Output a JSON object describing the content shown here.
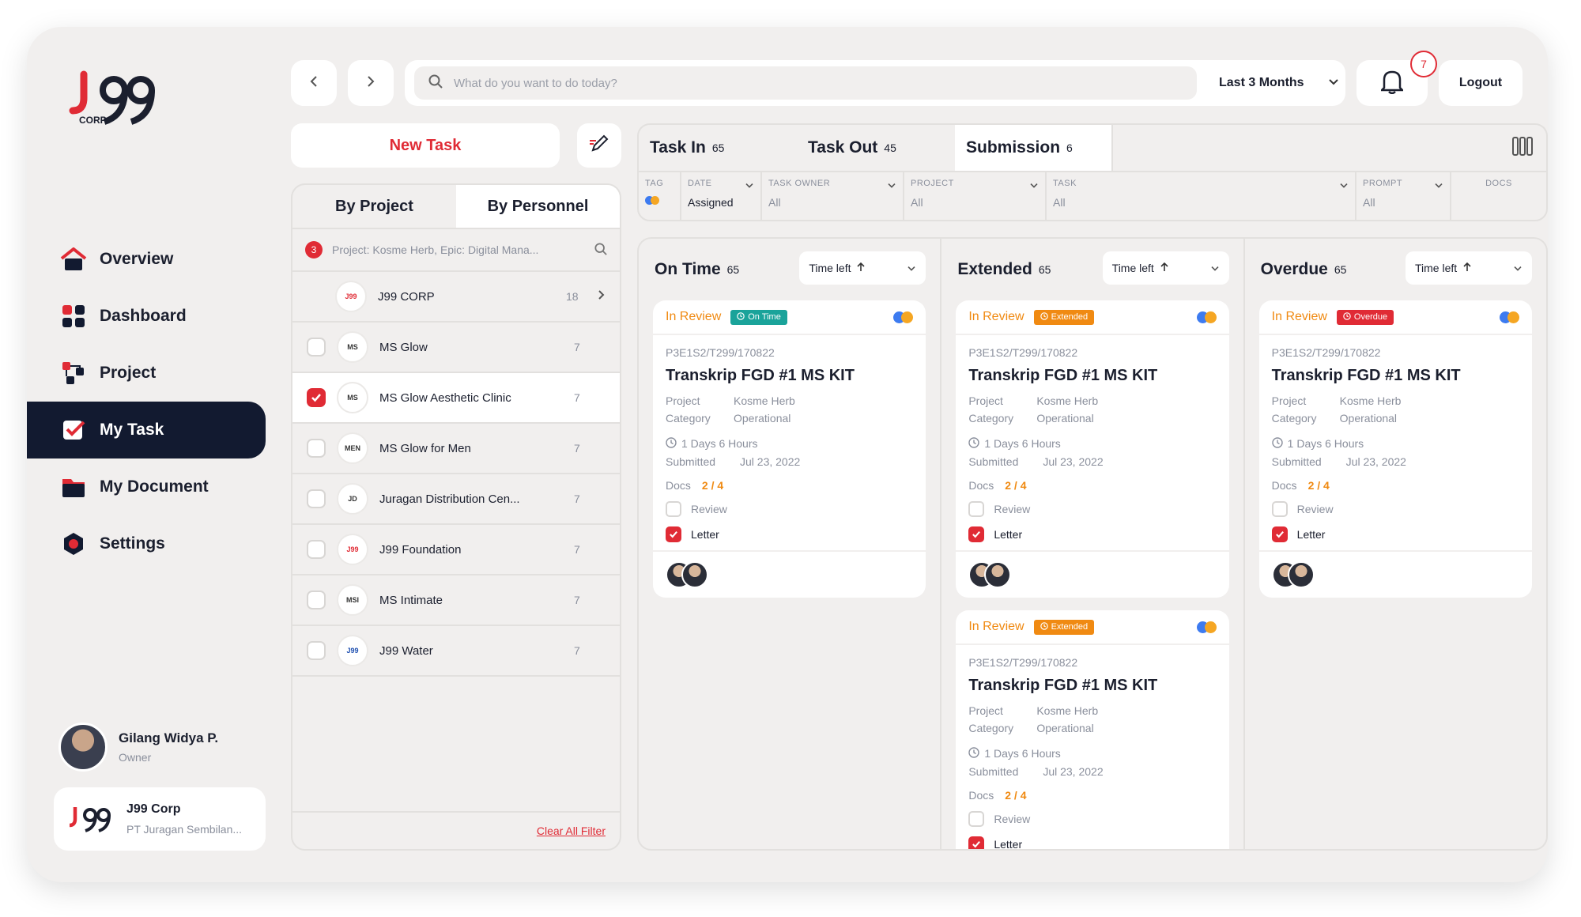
{
  "brand": {
    "logo_text": "J99",
    "logo_sub": "CORP."
  },
  "nav": [
    {
      "label": "Overview",
      "icon": "home-icon"
    },
    {
      "label": "Dashboard",
      "icon": "grid-icon"
    },
    {
      "label": "Project",
      "icon": "project-icon"
    },
    {
      "label": "My Task",
      "icon": "task-check-icon",
      "active": true
    },
    {
      "label": "My Document",
      "icon": "folder-icon"
    },
    {
      "label": "Settings",
      "icon": "gear-icon"
    }
  ],
  "user": {
    "name": "Gilang Widya P.",
    "role": "Owner"
  },
  "company": {
    "name": "J99 Corp",
    "subtitle": "PT Juragan Sembilan..."
  },
  "topbar": {
    "search_placeholder": "What do you want to do today?",
    "range": "Last 3 Months",
    "notifications": "7",
    "logout": "Logout"
  },
  "left": {
    "new_task": "New Task",
    "tabs": [
      "By Project",
      "By Personnel"
    ],
    "query_count": "3",
    "query_text": "Project: Kosme Herb, Epic: Digital Mana...",
    "parent": {
      "name": "J99 CORP",
      "count": "18"
    },
    "rows": [
      {
        "name": "MS Glow",
        "count": "7",
        "checked": false
      },
      {
        "name": "MS Glow Aesthetic Clinic",
        "count": "7",
        "checked": true
      },
      {
        "name": "MS Glow for Men",
        "count": "7",
        "checked": false
      },
      {
        "name": "Juragan Distribution Cen...",
        "count": "7",
        "checked": false
      },
      {
        "name": "J99 Foundation",
        "count": "7",
        "checked": false
      },
      {
        "name": "MS Intimate",
        "count": "7",
        "checked": false
      },
      {
        "name": "J99 Water",
        "count": "7",
        "checked": false
      }
    ],
    "clear": "Clear All Filter"
  },
  "tabs": [
    {
      "label": "Task In",
      "count": "65"
    },
    {
      "label": "Task Out",
      "count": "45"
    },
    {
      "label": "Submission",
      "count": "6"
    }
  ],
  "filters": [
    {
      "head": "TAG",
      "value": ""
    },
    {
      "head": "DATE",
      "value": "Assigned"
    },
    {
      "head": "TASK OWNER",
      "value": "All"
    },
    {
      "head": "PROJECT",
      "value": "All"
    },
    {
      "head": "TASK",
      "value": "All"
    },
    {
      "head": "PROMPT",
      "value": "All"
    },
    {
      "head": "DOCS",
      "value": ""
    }
  ],
  "columns": [
    {
      "title": "On Time",
      "count": "65",
      "sort": "Time left",
      "tag": "On Time",
      "tag_color": "#1aa39a",
      "cards": 1
    },
    {
      "title": "Extended",
      "count": "65",
      "sort": "Time left",
      "tag": "Extended",
      "tag_color": "#f08a12",
      "cards": 2
    },
    {
      "title": "Overdue",
      "count": "65",
      "sort": "Time left",
      "tag": "Overdue",
      "tag_color": "#e02b35",
      "cards": 1
    }
  ],
  "card": {
    "status": "In Review",
    "code": "P3E1S2/T299/170822",
    "title": "Transkrip FGD #1 MS KIT",
    "project_label": "Project",
    "project": "Kosme Herb",
    "category_label": "Category",
    "category": "Operational",
    "time": "1 Days 6 Hours",
    "submitted_label": "Submitted",
    "submitted": "Jul 23, 2022",
    "docs_label": "Docs",
    "docs": "2 / 4",
    "checks": [
      {
        "label": "Review",
        "checked": false
      },
      {
        "label": "Letter",
        "checked": true
      }
    ]
  },
  "colors": {
    "accent": "#e02b35",
    "navy": "#121a30",
    "orange": "#f08a12",
    "teal": "#1aa39a"
  }
}
